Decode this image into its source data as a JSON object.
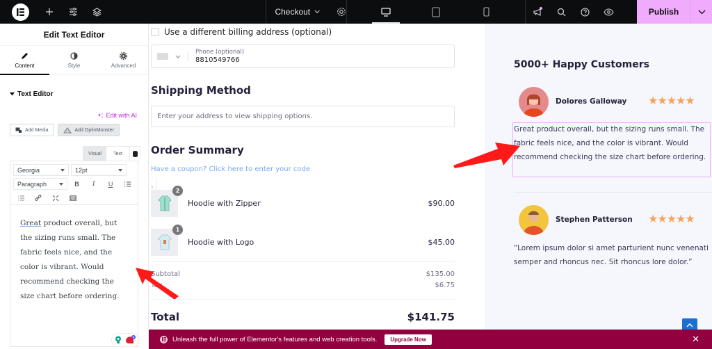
{
  "topbar": {
    "page_name": "Checkout",
    "publish_label": "Publish",
    "icons": [
      "elementor-logo-icon",
      "plus-icon",
      "sliders-icon",
      "layers-icon",
      "chevron-down-icon",
      "gear-icon",
      "desktop-icon",
      "tablet-icon",
      "mobile-icon",
      "megaphone-icon",
      "search-icon",
      "help-icon",
      "eye-icon",
      "chevron-down-icon"
    ]
  },
  "panel": {
    "title": "Edit Text Editor",
    "tabs": [
      {
        "label": "Content",
        "icon": "pencil-icon",
        "active": true
      },
      {
        "label": "Style",
        "icon": "contrast-icon",
        "active": false
      },
      {
        "label": "Advanced",
        "icon": "gear-icon",
        "active": false
      }
    ],
    "section_title": "Text Editor",
    "edit_ai_label": "Edit with AI",
    "add_media_label": "Add Media",
    "add_optin_label": "Add OptinMonster",
    "visual_tab": "Visual",
    "text_tab": "Text",
    "font_family": "Georgia",
    "font_size": "12pt",
    "block_format": "Paragraph",
    "editor_first_word": "Great",
    "editor_text_rest": " product overall, but the sizing runs small. The fabric feels nice, and the color is vibrant. Would recommend checking the size chart before ordering."
  },
  "checkout": {
    "billing_checkbox_label": "Use a different billing address (optional)",
    "phone_label": "Phone (optional)",
    "phone_value": "8810549766",
    "shipping_title": "Shipping Method",
    "shipping_placeholder": "Enter your address to view shipping options.",
    "order_title": "Order Summary",
    "coupon_link": "Have a coupon? Click here to enter your code",
    "items": [
      {
        "name": "Hoodie with Zipper",
        "qty": "2",
        "price": "$90.00"
      },
      {
        "name": "Hoodie with Logo",
        "qty": "1",
        "price": "$45.00"
      }
    ],
    "subtotal_label": "Subtotal",
    "subtotal_value": "$135.00",
    "tax_label": "Tax",
    "tax_value": "$6.75",
    "total_label": "Total",
    "total_value": "$141.75"
  },
  "reviews": {
    "title": "5000+ Happy Customers",
    "items": [
      {
        "name": "Dolores Galloway",
        "rating": 5,
        "stars": "★★★★★",
        "text": "Great product overall, but the sizing runs small. The fabric feels nice, and the color is vibrant. Would recommend checking the size chart before ordering."
      },
      {
        "name": "Stephen Patterson",
        "rating": 5,
        "stars": "★★★★★",
        "text": "“Lorem ipsum dolor si amet parturient nunc venenati semper and rhoncus nec. Sit rhoncus lore dolor.”"
      }
    ]
  },
  "promo": {
    "text": "Unleash the full power of Elementor's features and web creation tools.",
    "button_label": "Upgrade Now"
  },
  "colors": {
    "publish_bg": "#f0abfc",
    "promo_bg": "#93003f",
    "ai_accent": "#c026d3",
    "star": "#f7a35c",
    "annotation_arrow": "#ff1a1a"
  }
}
